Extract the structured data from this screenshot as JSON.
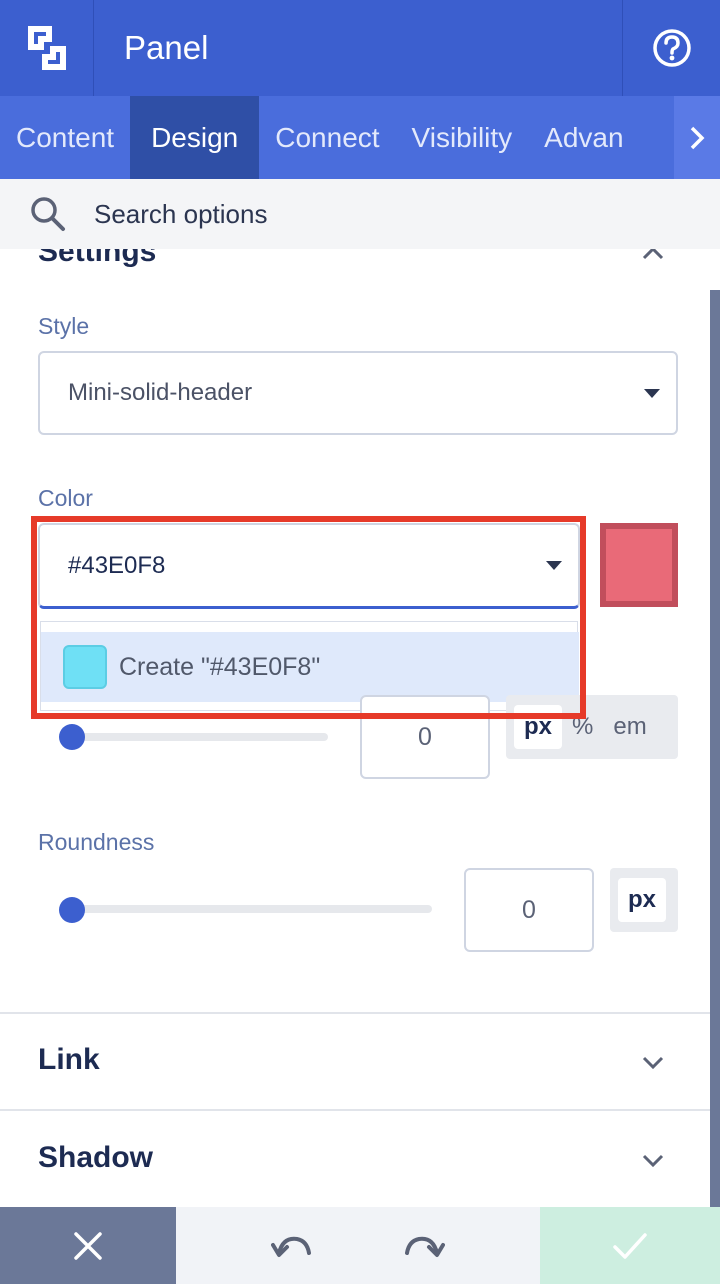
{
  "header": {
    "title": "Panel"
  },
  "tabs": [
    {
      "label": "Content",
      "active": false
    },
    {
      "label": "Design",
      "active": true
    },
    {
      "label": "Connect",
      "active": false
    },
    {
      "label": "Visibility",
      "active": false
    },
    {
      "label": "Advan",
      "active": false
    }
  ],
  "search": {
    "placeholder": "Search options"
  },
  "settings": {
    "title": "Settings",
    "style": {
      "label": "Style",
      "value": "Mini-solid-header"
    },
    "color": {
      "label": "Color",
      "value": "#43E0F8",
      "swatch_color": "#e96a78",
      "dropdown_option": "Create \"#43E0F8\"",
      "option_chip_color": "#6fe0f5"
    },
    "border": {
      "value": "0",
      "units": [
        "px",
        "%",
        "em"
      ],
      "active_unit": "px",
      "slider_fraction": 0
    },
    "roundness": {
      "label": "Roundness",
      "value": "0",
      "units": [
        "px"
      ],
      "active_unit": "px",
      "slider_fraction": 0
    }
  },
  "sections": [
    {
      "title": "Link"
    },
    {
      "title": "Shadow"
    }
  ],
  "colors": {
    "primary": "#3c5fcf",
    "highlight_border": "#e63a29",
    "close_bar": "#6b7898",
    "confirm_bar": "#cdeee0"
  }
}
